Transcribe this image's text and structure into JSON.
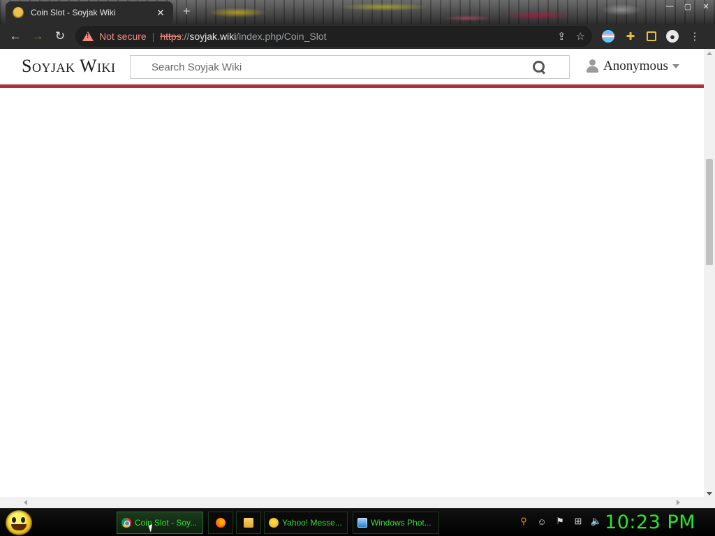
{
  "browser": {
    "tab": {
      "title": "Coin Slot - Soyjak Wiki",
      "close": "✕"
    },
    "new_tab": "+",
    "window_controls": {
      "minimize": "—",
      "maximize": "▢",
      "close": "✕"
    },
    "nav": {
      "back": "←",
      "forward": "→",
      "reload": "↻"
    },
    "address": {
      "security_label": "Not secure",
      "scheme": "https",
      "scheme_rest": "://",
      "host": "soyjak.wiki",
      "path": "/index.php/Coin_Slot"
    },
    "omnibox_icons": {
      "share": "⇪",
      "bookmark": "☆"
    },
    "toolbar_icons": {
      "extensions": "✚",
      "profile": "●",
      "menu": "⋮"
    }
  },
  "wiki": {
    "logo": "Soyjak Wiki",
    "search": {
      "placeholder": "Search Soyjak Wiki",
      "value": ""
    },
    "user": {
      "name": "Anonymous"
    },
    "accent_color": "#b22f36"
  },
  "taskbar": {
    "items": [
      {
        "label": "Coin Slot - Soy...",
        "icon": "chrome-icon",
        "active": true
      },
      {
        "label": "",
        "icon": "firefox-icon",
        "active": false
      },
      {
        "label": "",
        "icon": "folder-icon",
        "active": false
      },
      {
        "label": "Yahoo! Messe...",
        "icon": "yahoo-messenger-icon",
        "active": false
      },
      {
        "label": "Windows Phot...",
        "icon": "windows-photo-icon",
        "active": false
      }
    ],
    "tray_icons": [
      "key-icon",
      "messenger-tray-icon",
      "action-center-flag-icon",
      "network-icon",
      "volume-icon"
    ],
    "tray_glyphs": {
      "key": "⚲",
      "messenger": "☺",
      "flag": "⚑",
      "network": "⊞",
      "volume": "🔈"
    },
    "clock": "10:23 PM",
    "text_color": "#3bdc3b"
  }
}
